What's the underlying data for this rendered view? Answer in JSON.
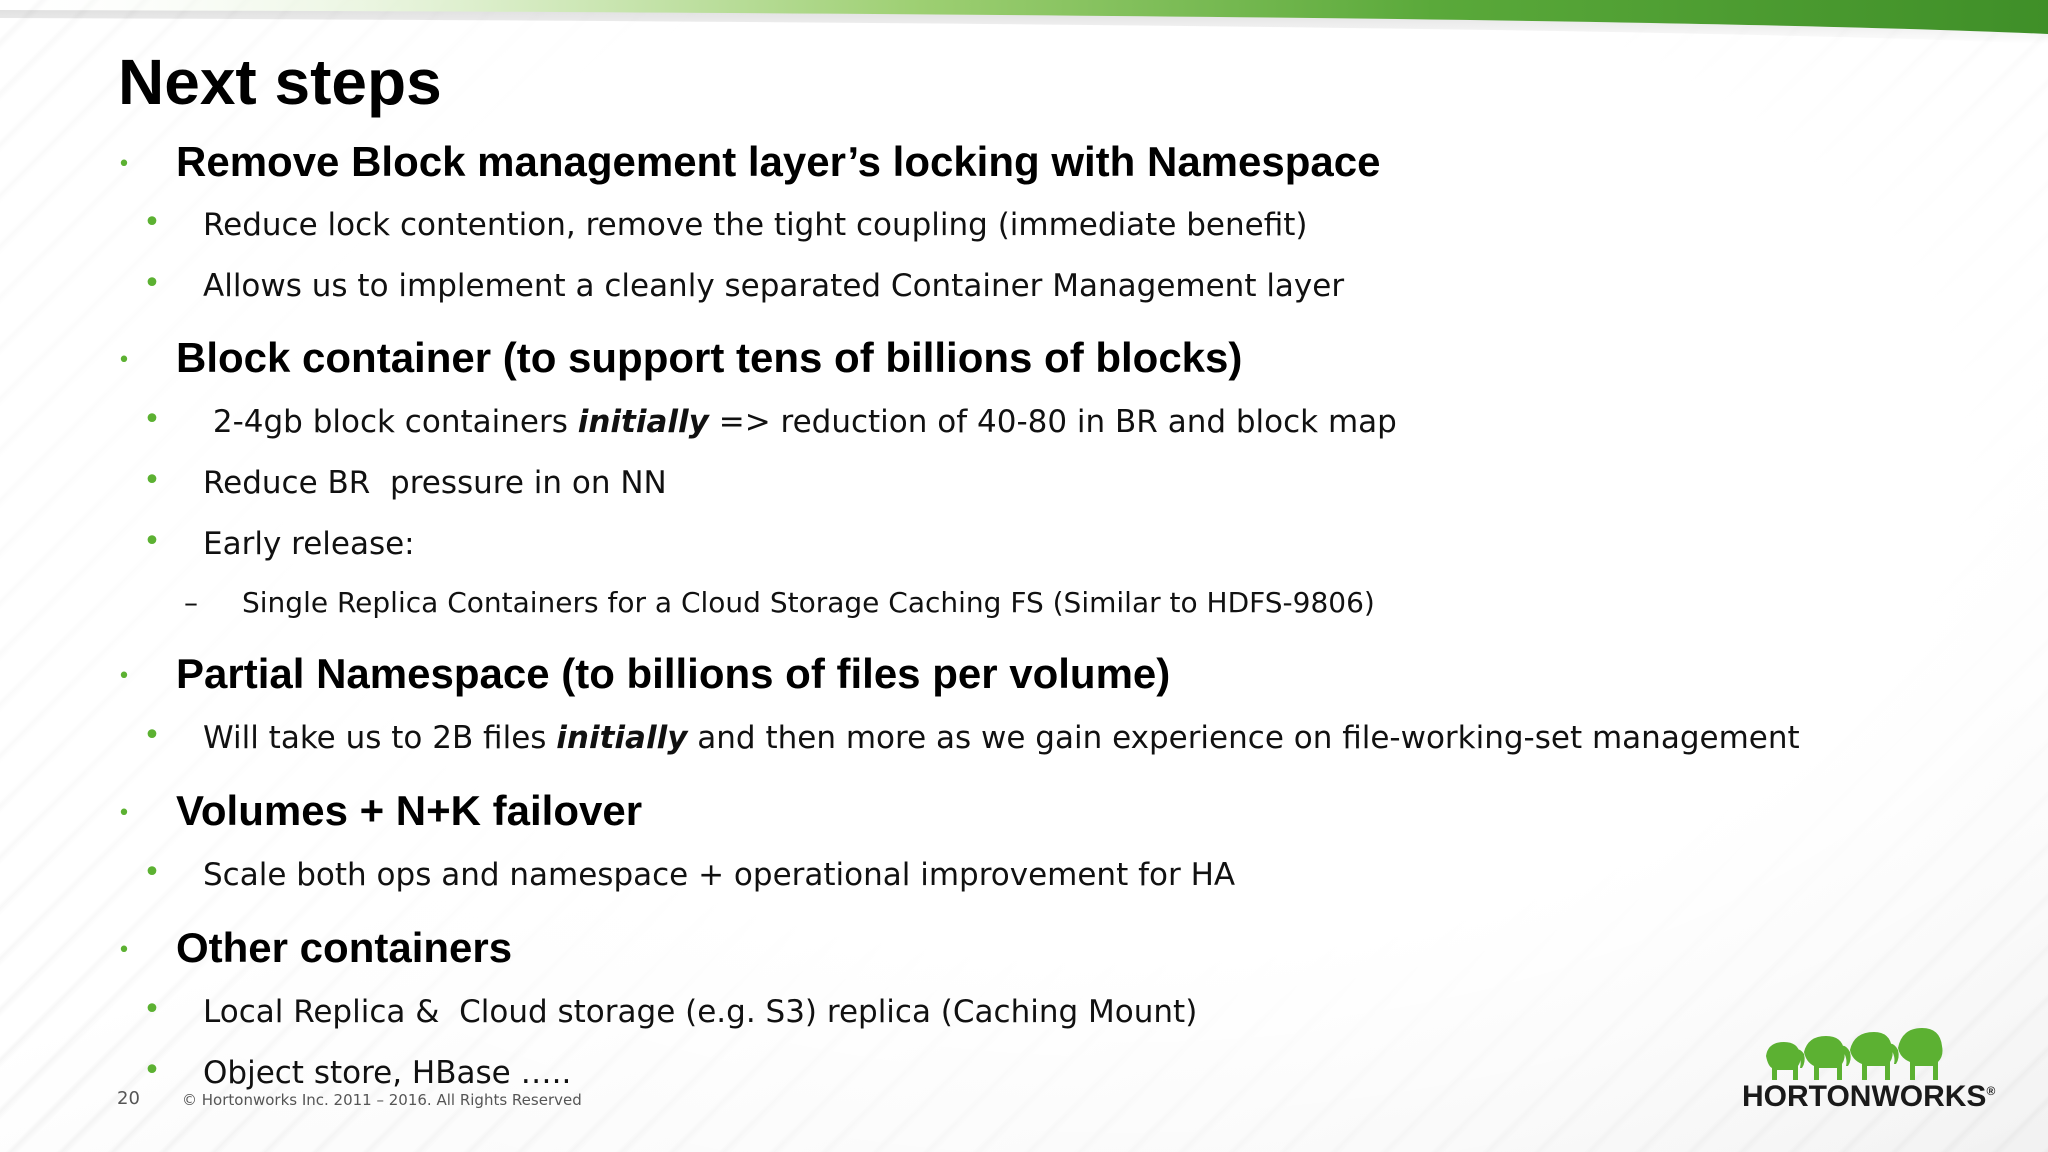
{
  "slide": {
    "title": "Next steps",
    "bullets": [
      {
        "heading": "Remove Block management layer’s locking with Namespace",
        "items": [
          {
            "text": "Reduce lock contention, remove  the tight coupling (immediate benefit)"
          },
          {
            "text": "Allows us to implement a cleanly separated Container Management layer"
          }
        ]
      },
      {
        "heading": "Block container (to support tens of billions of blocks)",
        "items": [
          {
            "pre": " 2-4gb block containers ",
            "emph": "initially",
            "post": " => reduction of 40-80 in BR and block map"
          },
          {
            "text": "Reduce BR  pressure in on NN"
          },
          {
            "text": "Early release:",
            "sub": [
              {
                "marker": "–",
                "text": "Single Replica Containers for a Cloud Storage Caching FS (Similar to HDFS-9806)"
              }
            ]
          }
        ]
      },
      {
        "heading": "Partial Namespace (to billions of files per volume)",
        "items": [
          {
            "pre": "Will take us to 2B files ",
            "emph": "initially",
            "post": " and then more as we gain experience on file-working-set management"
          }
        ]
      },
      {
        "heading": "Volumes + N+K failover",
        "items": [
          {
            "text": "Scale both ops and namespace + operational improvement for HA"
          }
        ]
      },
      {
        "heading": "Other containers",
        "items": [
          {
            "text": "Local Replica &  Cloud storage (e.g. S3) replica (Caching Mount)"
          },
          {
            "text": "Object store, HBase ….."
          }
        ]
      }
    ],
    "bullet_marker": "•",
    "bullet_color": "#5cb132"
  },
  "footer": {
    "page_number": "20",
    "copyright": "© Hortonworks Inc. 2011 – 2016. All Rights Reserved"
  },
  "logo": {
    "text": "HORTONWORKS",
    "registered_mark": "®",
    "icon": "elephants-herd-icon",
    "color": "#5cb132"
  },
  "theme": {
    "accent_green": "#5cb132",
    "top_bar_gradient": [
      "#ffffff",
      "#a6d57e",
      "#4c9c2e",
      "#3f8f28"
    ]
  }
}
